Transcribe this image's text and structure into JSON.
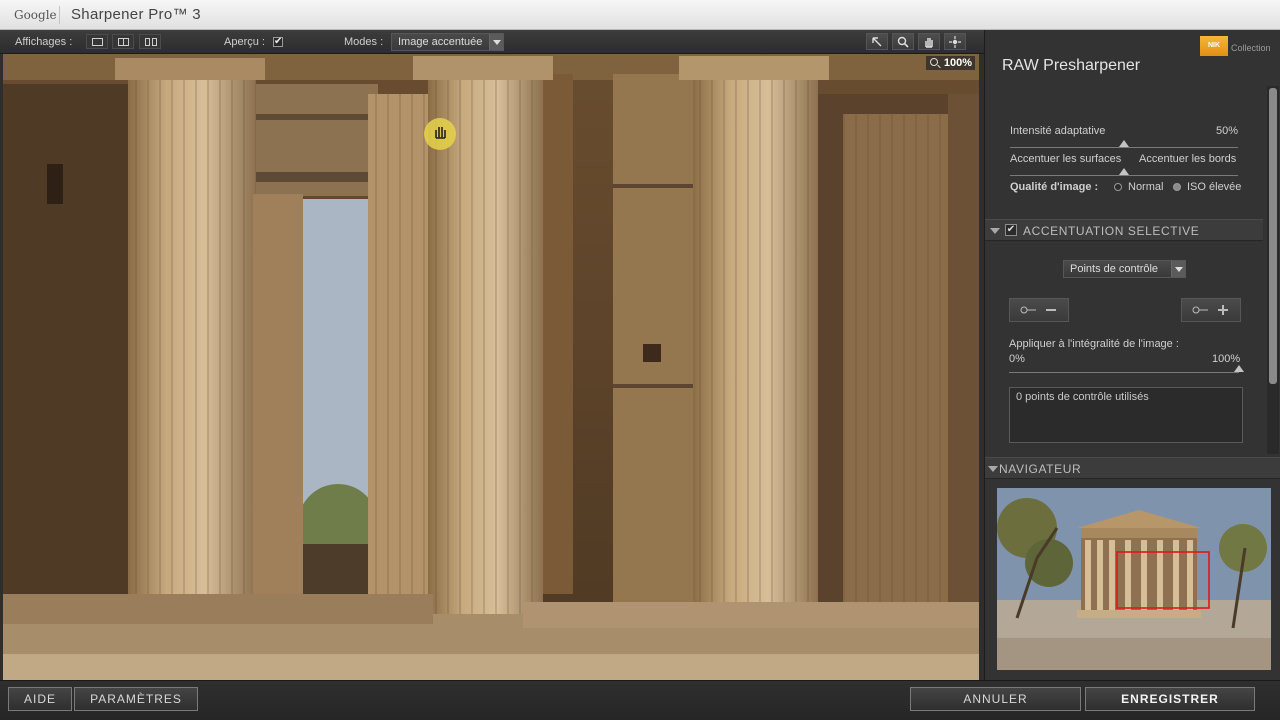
{
  "titlebar": {
    "brand": "Google",
    "app_title": "Sharpener Pro™ 3"
  },
  "toolbar": {
    "views_label": "Affichages :",
    "preview_label": "Aperçu :",
    "preview_checked": "✔",
    "modes_label": "Modes :",
    "mode_value": "Image accentuée"
  },
  "preview": {
    "zoom": "100%"
  },
  "panel": {
    "brand_badge": "NIK",
    "brand_collection": "Collection",
    "filter_title": "RAW Presharpener",
    "adaptive_label": "Intensité adaptative",
    "adaptive_value": "50%",
    "surfaces_label": "Accentuer les surfaces",
    "edges_label": "Accentuer les bords",
    "quality_label": "Qualité d'image :",
    "quality_options": [
      "Normal",
      "ISO élevée"
    ],
    "selective_title": "ACCENTUATION SELECTIVE",
    "selective_checked": "✔",
    "cp_select": "Points de contrôle",
    "apply_label": "Appliquer à l'intégralité de l'image :",
    "apply_min": "0%",
    "apply_max": "100%",
    "cp_count": "0 points de contrôle utilisés",
    "navigator_title": "NAVIGATEUR"
  },
  "bottom": {
    "help": "AIDE",
    "settings": "PARAMÈTRES",
    "cancel": "ANNULER",
    "save": "ENREGISTRER"
  },
  "colors": {
    "accent_brand": "#f0a020",
    "navigator_box": "#e01818"
  }
}
